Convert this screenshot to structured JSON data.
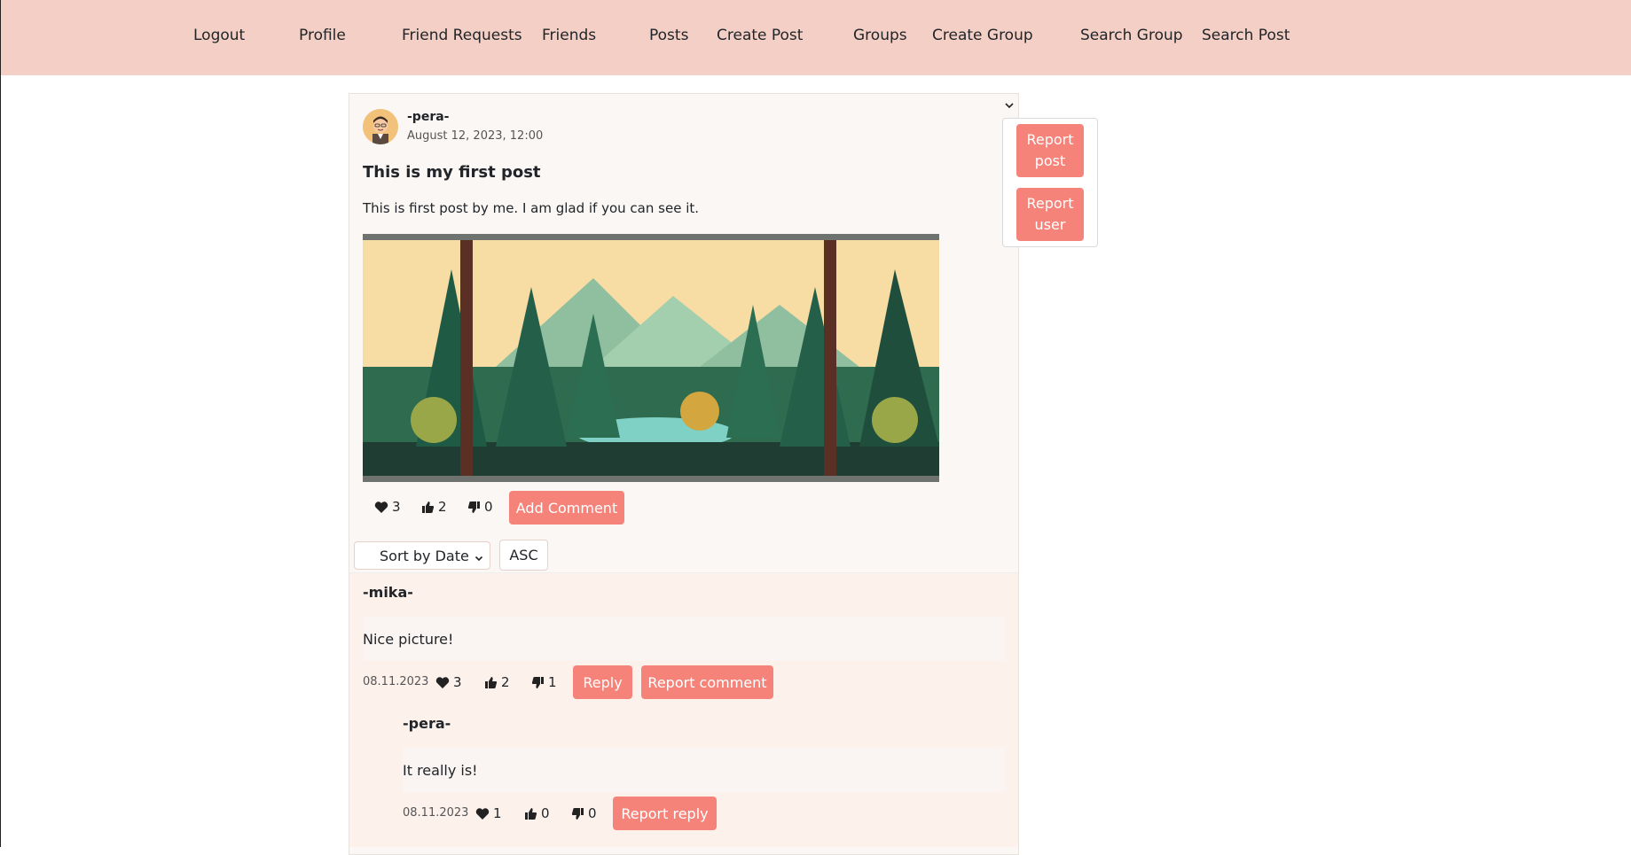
{
  "nav": {
    "logout": "Logout",
    "profile": "Profile",
    "friend_requests": "Friend Requests",
    "friends": "Friends",
    "posts": "Posts",
    "create_post": "Create Post",
    "groups": "Groups",
    "create_group": "Create Group",
    "search_group": "Search Group",
    "search_post": "Search Post"
  },
  "post": {
    "author": "-pera-",
    "date": "August 12, 2023, 12:00",
    "title": "This is my first post",
    "body": "This is first post by me. I am glad if you can see it.",
    "image": "forest-illustration",
    "hearts": "3",
    "likes": "2",
    "dislikes": "0",
    "add_comment_label": "Add Comment"
  },
  "menu": {
    "report_post_label": "Report post",
    "report_user_label": "Report user"
  },
  "sort": {
    "selected": "Sort by Date",
    "order_label": "ASC"
  },
  "comments": [
    {
      "author": "-mika-",
      "text": "Nice picture!",
      "date": "08.11.2023",
      "hearts": "3",
      "likes": "2",
      "dislikes": "1",
      "reply_label": "Reply",
      "report_label": "Report comment",
      "replies": [
        {
          "author": "-pera-",
          "text": "It really is!",
          "date": "08.11.2023",
          "hearts": "1",
          "likes": "0",
          "dislikes": "0",
          "report_label": "Report reply"
        }
      ]
    }
  ],
  "colors": {
    "nav_bg": "#f4cfc5",
    "accent": "#f5837a",
    "comment_bg": "#fdf1ec"
  }
}
